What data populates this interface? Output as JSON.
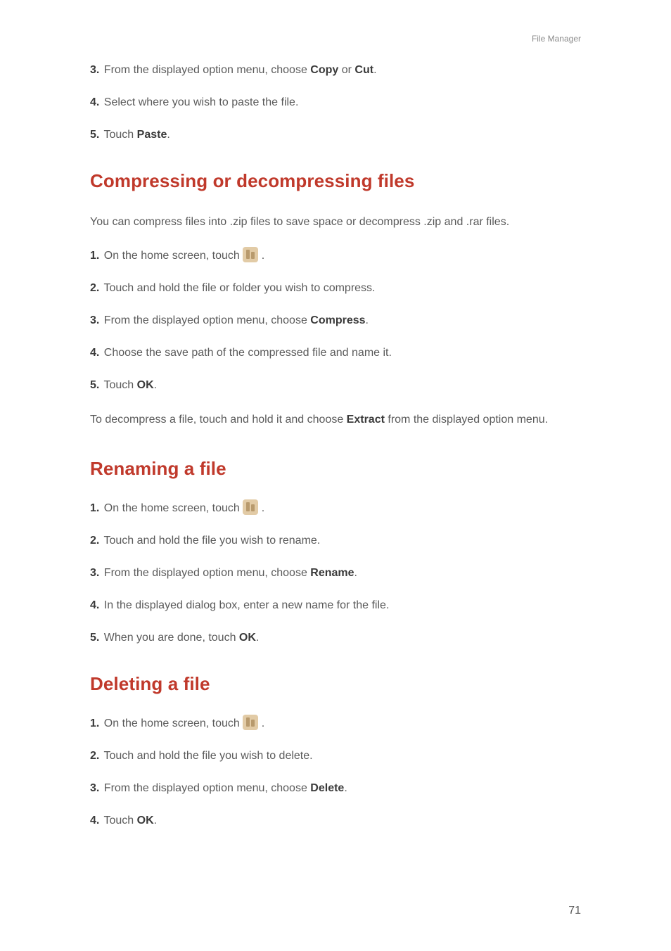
{
  "header": {
    "section": "File Manager"
  },
  "intro_steps": [
    {
      "num": "3.",
      "pre": "From the displayed option menu, choose ",
      "bold1": "Copy",
      "mid": " or ",
      "bold2": "Cut",
      "post": "."
    },
    {
      "num": "4.",
      "pre": "Select where you wish to paste the file.",
      "bold1": "",
      "mid": "",
      "bold2": "",
      "post": ""
    },
    {
      "num": "5.",
      "pre": "Touch ",
      "bold1": "Paste",
      "mid": "",
      "bold2": "",
      "post": "."
    }
  ],
  "section1": {
    "title": "Compressing or decompressing files",
    "para": "You can compress files into .zip files to save space or decompress .zip and .rar files.",
    "steps": [
      {
        "num": "1.",
        "pre": "On the home screen, touch ",
        "icon": true,
        "post": " ."
      },
      {
        "num": "2.",
        "pre": "Touch and hold the file or folder you wish to compress.",
        "post": ""
      },
      {
        "num": "3.",
        "pre": "From the displayed option menu, choose ",
        "bold": "Compress",
        "post": "."
      },
      {
        "num": "4.",
        "pre": "Choose the save path of the compressed file and name it.",
        "post": ""
      },
      {
        "num": "5.",
        "pre": "Touch ",
        "bold": "OK",
        "post": "."
      }
    ],
    "tail_pre": "To decompress a file, touch and hold it and choose ",
    "tail_bold": "Extract",
    "tail_post": " from the displayed option menu."
  },
  "section2": {
    "title": "Renaming a file",
    "steps": [
      {
        "num": "1.",
        "pre": "On the home screen, touch ",
        "icon": true,
        "post": " ."
      },
      {
        "num": "2.",
        "pre": "Touch and hold the file you wish to rename.",
        "post": ""
      },
      {
        "num": "3.",
        "pre": "From the displayed option menu, choose ",
        "bold": "Rename",
        "post": "."
      },
      {
        "num": "4.",
        "pre": "In the displayed dialog box, enter a new name for the file.",
        "post": ""
      },
      {
        "num": "5.",
        "pre": "When you are done, touch ",
        "bold": "OK",
        "post": "."
      }
    ]
  },
  "section3": {
    "title": "Deleting a file",
    "steps": [
      {
        "num": "1.",
        "pre": "On the home screen, touch ",
        "icon": true,
        "post": " ."
      },
      {
        "num": "2.",
        "pre": "Touch and hold the file you wish to delete.",
        "post": ""
      },
      {
        "num": "3.",
        "pre": "From the displayed option menu, choose ",
        "bold": "Delete",
        "post": "."
      },
      {
        "num": "4.",
        "pre": "Touch ",
        "bold": "OK",
        "post": "."
      }
    ]
  },
  "pagenum": "71"
}
